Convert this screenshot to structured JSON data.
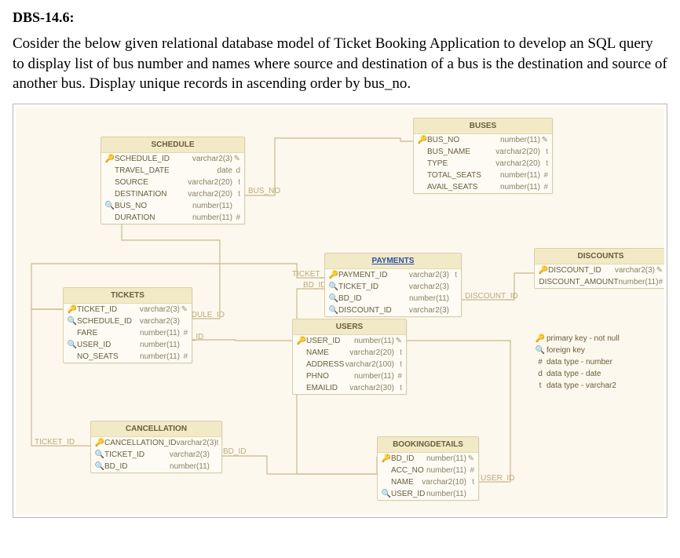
{
  "question": {
    "id": "DBS-14.6:",
    "text": "Cosider the below given relational database model of Ticket Booking Application to develop an SQL query to display list of bus number and names where source and destination of a bus is the destination and source of another bus. Display unique records in ascending order by bus_no."
  },
  "entities": {
    "schedule": {
      "title": "SCHEDULE",
      "fields": [
        {
          "icon": "pk",
          "name": "SCHEDULE_ID",
          "type": "varchar2(3)",
          "flag": "✎"
        },
        {
          "icon": "",
          "name": "TRAVEL_DATE",
          "type": "date",
          "flag": "d"
        },
        {
          "icon": "",
          "name": "SOURCE",
          "type": "varchar2(20)",
          "flag": "t"
        },
        {
          "icon": "",
          "name": "DESTINATION",
          "type": "varchar2(20)",
          "flag": "t"
        },
        {
          "icon": "fk",
          "name": "BUS_NO",
          "type": "number(11)",
          "flag": ""
        },
        {
          "icon": "",
          "name": "DURATION",
          "type": "number(11)",
          "flag": "#"
        }
      ]
    },
    "buses": {
      "title": "BUSES",
      "fields": [
        {
          "icon": "pk",
          "name": "BUS_NO",
          "type": "number(11)",
          "flag": "✎"
        },
        {
          "icon": "",
          "name": "BUS_NAME",
          "type": "varchar2(20)",
          "flag": "t"
        },
        {
          "icon": "",
          "name": "TYPE",
          "type": "varchar2(20)",
          "flag": "t"
        },
        {
          "icon": "",
          "name": "TOTAL_SEATS",
          "type": "number(11)",
          "flag": "#"
        },
        {
          "icon": "",
          "name": "AVAIL_SEATS",
          "type": "number(11)",
          "flag": "#"
        }
      ]
    },
    "tickets": {
      "title": "TICKETS",
      "fields": [
        {
          "icon": "pk",
          "name": "TICKET_ID",
          "type": "varchar2(3)",
          "flag": "✎"
        },
        {
          "icon": "fk",
          "name": "SCHEDULE_ID",
          "type": "varchar2(3)",
          "flag": ""
        },
        {
          "icon": "",
          "name": "FARE",
          "type": "number(11)",
          "flag": "#"
        },
        {
          "icon": "fk",
          "name": "USER_ID",
          "type": "number(11)",
          "flag": ""
        },
        {
          "icon": "",
          "name": "NO_SEATS",
          "type": "number(11)",
          "flag": "#"
        }
      ]
    },
    "payments": {
      "title": "PAYMENTS",
      "title_link": true,
      "fields": [
        {
          "icon": "pk",
          "name": "PAYMENT_ID",
          "type": "varchar2(3)",
          "flag": "t"
        },
        {
          "icon": "fk",
          "name": "TICKET_ID",
          "type": "varchar2(3)",
          "flag": ""
        },
        {
          "icon": "fk",
          "name": "BD_ID",
          "type": "number(11)",
          "flag": ""
        },
        {
          "icon": "fk",
          "name": "DISCOUNT_ID",
          "type": "varchar2(3)",
          "flag": ""
        }
      ]
    },
    "discounts": {
      "title": "DISCOUNTS",
      "fields": [
        {
          "icon": "pk",
          "name": "DISCOUNT_ID",
          "type": "varchar2(3)",
          "flag": "✎"
        },
        {
          "icon": "",
          "name": "DISCOUNT_AMOUNT",
          "type": "number(11)",
          "flag": "#"
        }
      ]
    },
    "users": {
      "title": "USERS",
      "fields": [
        {
          "icon": "pk",
          "name": "USER_ID",
          "type": "number(11)",
          "flag": "✎"
        },
        {
          "icon": "",
          "name": "NAME",
          "type": "varchar2(20)",
          "flag": "t"
        },
        {
          "icon": "",
          "name": "ADDRESS",
          "type": "varchar2(100)",
          "flag": "t"
        },
        {
          "icon": "",
          "name": "PHNO",
          "type": "number(11)",
          "flag": "#"
        },
        {
          "icon": "",
          "name": "EMAILID",
          "type": "varchar2(30)",
          "flag": "t"
        }
      ]
    },
    "cancellation": {
      "title": "CANCELLATION",
      "fields": [
        {
          "icon": "pk",
          "name": "CANCELLATION_ID",
          "type": "varchar2(3)",
          "flag": "t"
        },
        {
          "icon": "fk",
          "name": "TICKET_ID",
          "type": "varchar2(3)",
          "flag": ""
        },
        {
          "icon": "fk",
          "name": "BD_ID",
          "type": "number(11)",
          "flag": ""
        }
      ]
    },
    "bookingdetails": {
      "title": "BOOKINGDETAILS",
      "fields": [
        {
          "icon": "pk",
          "name": "BD_ID",
          "type": "number(11)",
          "flag": "✎"
        },
        {
          "icon": "",
          "name": "ACC_NO",
          "type": "number(11)",
          "flag": "#"
        },
        {
          "icon": "",
          "name": "NAME",
          "type": "varchar2(10)",
          "flag": "t"
        },
        {
          "icon": "fk",
          "name": "USER_ID",
          "type": "number(11)",
          "flag": ""
        }
      ]
    }
  },
  "edge_labels": {
    "schedule_buses": "BUS_NO",
    "tickets_schedule": "SCHEDULE_ID",
    "tickets_users": "USER_ID",
    "payments_ticket": "TICKET_ID",
    "payments_bd": "BD_ID",
    "payments_discount": "DISCOUNT_ID",
    "cancel_ticket": "TICKET_ID",
    "cancel_bd": "BD_ID",
    "booking_user": "USER_ID"
  },
  "legend": {
    "pk": "primary key - not null",
    "fk": "foreign key",
    "num": "data type - number",
    "date": "data type - date",
    "varchar": "data type - varchar2"
  },
  "icons": {
    "pk_glyph": "🔑",
    "fk_glyph": "🔍",
    "num_glyph": "#",
    "date_glyph": "d",
    "varchar_glyph": "t"
  }
}
